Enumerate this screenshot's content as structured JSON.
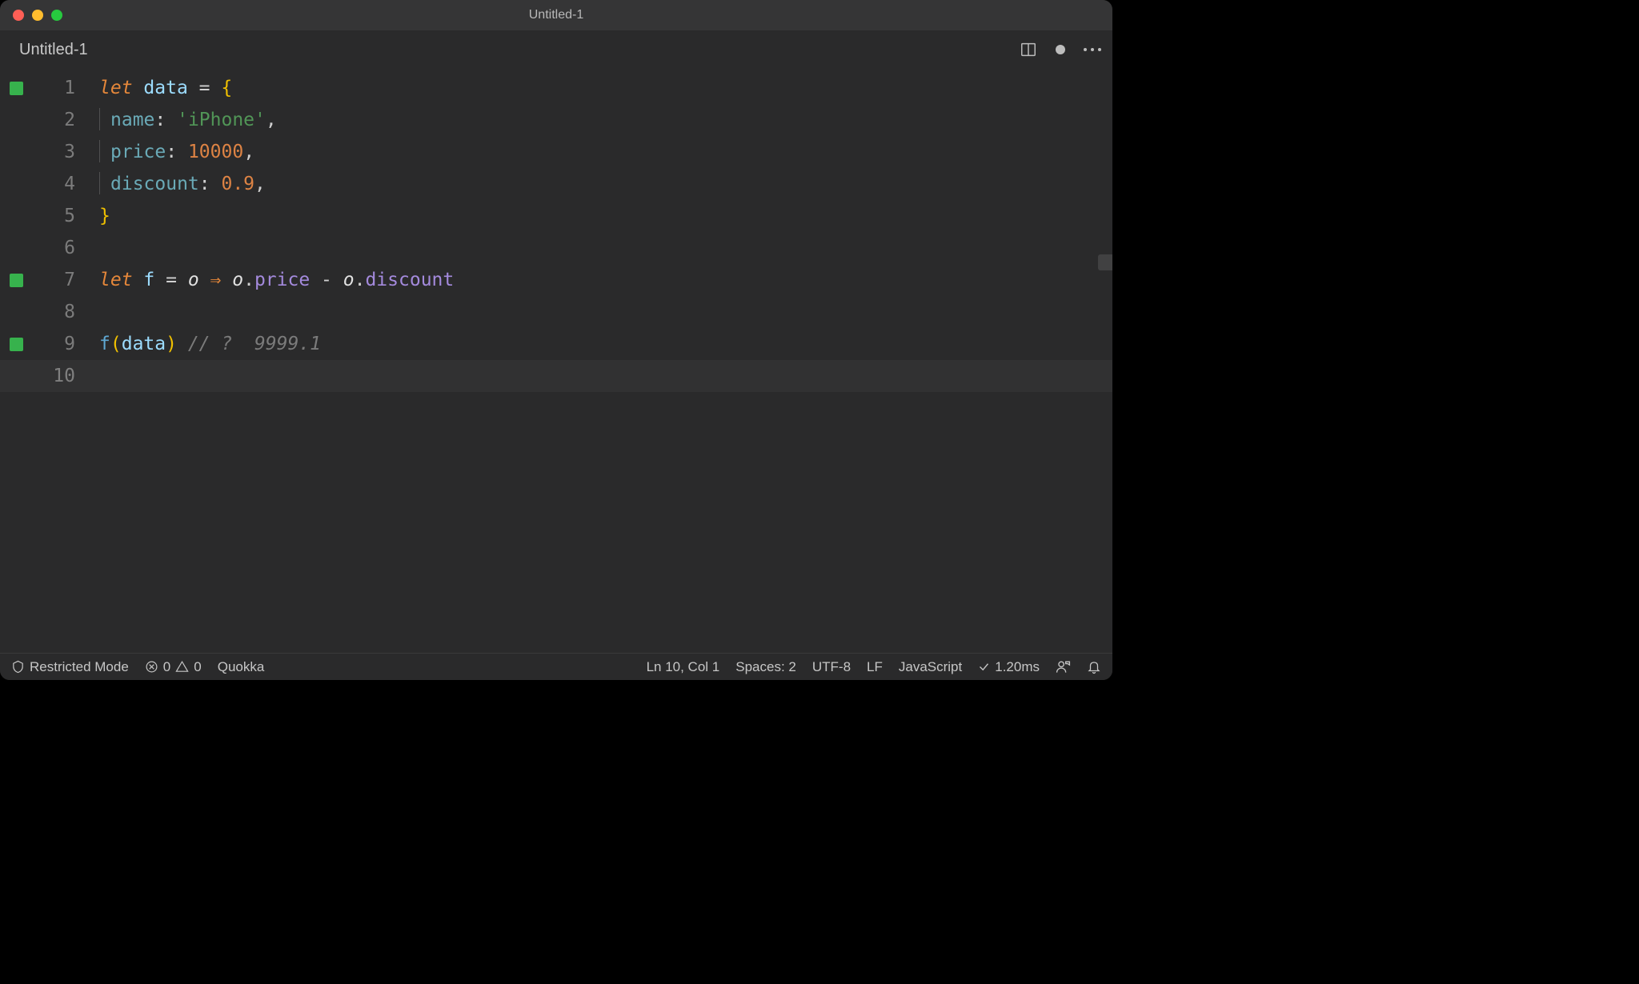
{
  "window": {
    "title": "Untitled-1"
  },
  "tab": {
    "label": "Untitled-1"
  },
  "editor": {
    "line_numbers": [
      "1",
      "2",
      "3",
      "4",
      "5",
      "6",
      "7",
      "8",
      "9",
      "10"
    ],
    "glyphs": [
      true,
      false,
      false,
      false,
      false,
      false,
      true,
      false,
      true,
      false
    ],
    "tokens": {
      "l1_let": "let",
      "l1_sp": " ",
      "l1_data": "data",
      "l1_eq": " = ",
      "l1_ob": "{",
      "l2_key": "name",
      "l2_colon": ": ",
      "l2_val": "'iPhone'",
      "l2_comma": ",",
      "l3_key": "price",
      "l3_colon": ": ",
      "l3_val": "10000",
      "l3_comma": ",",
      "l4_key": "discount",
      "l4_colon": ": ",
      "l4_val": "0.9",
      "l4_comma": ",",
      "l5_cb": "}",
      "l7_let": "let",
      "l7_sp": " ",
      "l7_f": "f",
      "l7_eq": " = ",
      "l7_o1": "o",
      "l7_arr": " ⇒ ",
      "l7_o2": "o",
      "l7_dot1": ".",
      "l7_price": "price",
      "l7_minus": " - ",
      "l7_o3": "o",
      "l7_dot2": ".",
      "l7_disc": "discount",
      "l9_f": "f",
      "l9_op": "(",
      "l9_data": "data",
      "l9_cp": ")",
      "l9_sp": " ",
      "l9_comment": "// ? ",
      "l9_inline": " 9999.1"
    }
  },
  "statusbar": {
    "restricted": "Restricted Mode",
    "errors": "0",
    "warnings": "0",
    "quokka": "Quokka",
    "position": "Ln 10, Col 1",
    "spaces": "Spaces: 2",
    "encoding": "UTF-8",
    "eol": "LF",
    "language": "JavaScript",
    "timing": "1.20ms"
  }
}
